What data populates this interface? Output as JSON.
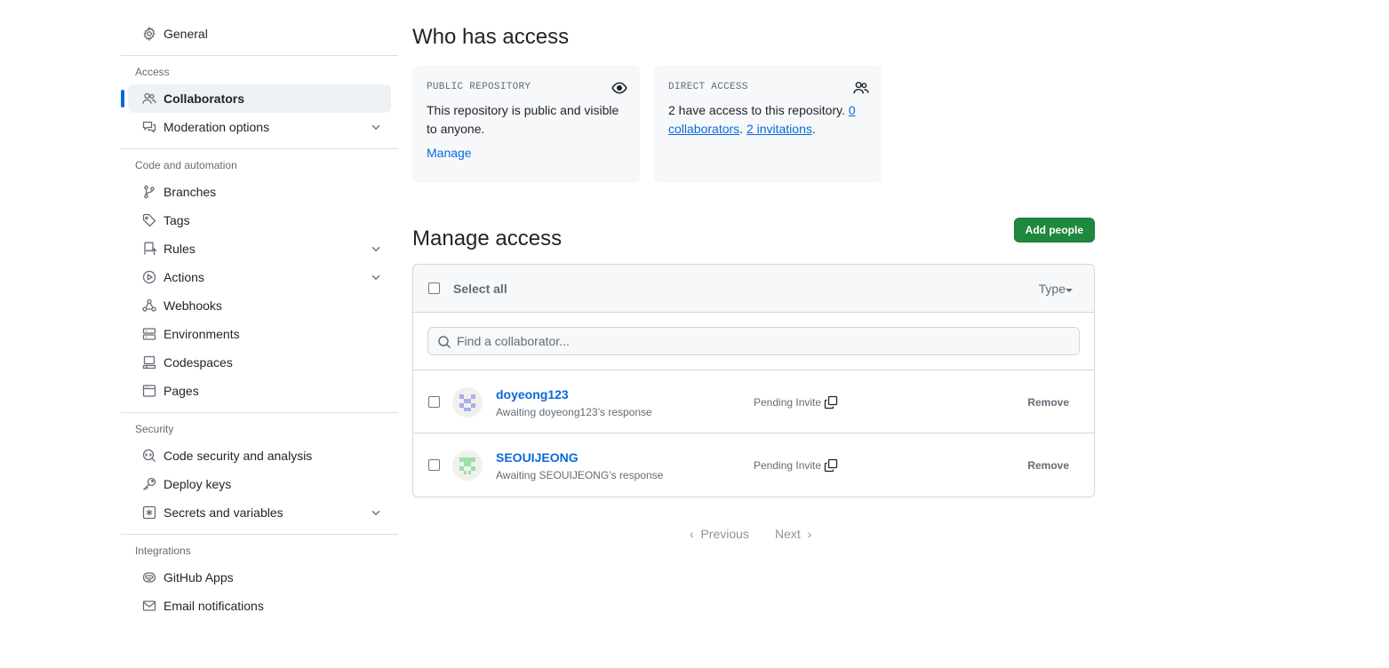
{
  "sidebar": {
    "general": "General",
    "groups": [
      {
        "title": "Access",
        "items": [
          {
            "label": "Collaborators",
            "icon": "people-icon",
            "active": true
          },
          {
            "label": "Moderation options",
            "icon": "comment-discussion-icon",
            "expandable": true
          }
        ]
      },
      {
        "title": "Code and automation",
        "items": [
          {
            "label": "Branches",
            "icon": "git-branch-icon"
          },
          {
            "label": "Tags",
            "icon": "tag-icon"
          },
          {
            "label": "Rules",
            "icon": "repo-push-icon",
            "expandable": true
          },
          {
            "label": "Actions",
            "icon": "play-icon",
            "expandable": true
          },
          {
            "label": "Webhooks",
            "icon": "webhook-icon"
          },
          {
            "label": "Environments",
            "icon": "server-icon"
          },
          {
            "label": "Codespaces",
            "icon": "codespaces-icon"
          },
          {
            "label": "Pages",
            "icon": "browser-icon"
          }
        ]
      },
      {
        "title": "Security",
        "items": [
          {
            "label": "Code security and analysis",
            "icon": "codescan-icon"
          },
          {
            "label": "Deploy keys",
            "icon": "key-icon"
          },
          {
            "label": "Secrets and variables",
            "icon": "key-asterisk-icon",
            "expandable": true
          }
        ]
      },
      {
        "title": "Integrations",
        "items": [
          {
            "label": "GitHub Apps",
            "icon": "hubot-icon"
          },
          {
            "label": "Email notifications",
            "icon": "mail-icon"
          }
        ]
      }
    ]
  },
  "who": {
    "title": "Who has access",
    "public_card": {
      "label": "PUBLIC REPOSITORY",
      "text": "This repository is public and visible to anyone.",
      "link": "Manage"
    },
    "direct_card": {
      "label": "DIRECT ACCESS",
      "count": "2",
      "text_mid": " have access to this repository. ",
      "collab_link": "0 collaborators",
      "sep": ". ",
      "invite_link": "2 invitations",
      "end": "."
    }
  },
  "manage": {
    "title": "Manage access",
    "add_button": "Add people",
    "select_all": "Select all",
    "type_filter": "Type",
    "search_placeholder": "Find a collaborator...",
    "rows": [
      {
        "username": "doyeong123",
        "status": "Awaiting doyeong123’s response",
        "role": "Pending Invite",
        "action": "Remove",
        "avatar_color": "#a7b0e6"
      },
      {
        "username": "SEOUIJEONG",
        "status": "Awaiting SEOUIJEONG’s response",
        "role": "Pending Invite",
        "action": "Remove",
        "avatar_color": "#9be0a8"
      }
    ],
    "pagination": {
      "previous": "Previous",
      "next": "Next"
    }
  }
}
